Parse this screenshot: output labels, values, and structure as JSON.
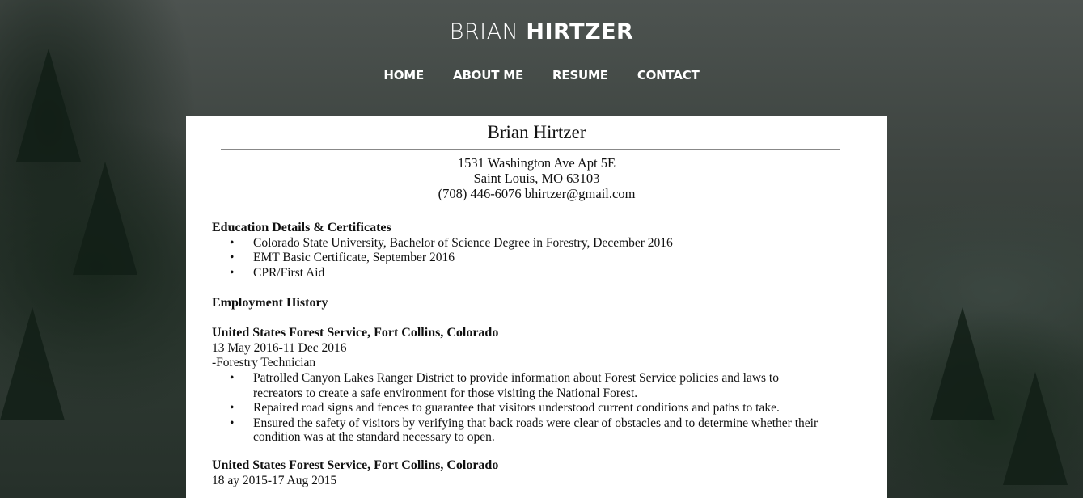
{
  "site": {
    "brand_first": "BRIAN",
    "brand_last": "HIRTZER",
    "nav": [
      "HOME",
      "ABOUT ME",
      "RESUME",
      "CONTACT"
    ]
  },
  "resume": {
    "name": "Brian Hirtzer",
    "address_line1": "1531 Washington Ave Apt 5E",
    "address_line2": "Saint Louis, MO 63103",
    "contact_line": "(708) 446-6076 bhirtzer@gmail.com",
    "education_heading": "Education Details & Certificates",
    "education": [
      "Colorado State University, Bachelor of Science Degree in Forestry, December 2016",
      "EMT Basic Certificate, September 2016",
      "CPR/First Aid"
    ],
    "employment_heading": "Employment History",
    "jobs": [
      {
        "employer": "United States Forest Service, Fort Collins, Colorado",
        "dates": "13 May 2016-11 Dec 2016",
        "title": "-Forestry Technician",
        "duties": [
          "Patrolled Canyon Lakes Ranger District to provide information about Forest Service policies and laws to recreators to create a safe environment for those visiting the National Forest.",
          "Repaired road signs and fences to guarantee that visitors understood current conditions and paths to take.",
          "Ensured the safety of visitors by verifying that back roads were clear of obstacles and to determine whether their condition was at the standard necessary to open."
        ]
      },
      {
        "employer": "United States Forest Service, Fort Collins, Colorado",
        "dates": "18  ay 2015-17 Aug 2015"
      }
    ]
  },
  "colors": {
    "text_on_bg": "#ffffff",
    "paper": "#ffffff",
    "rule": "#888888"
  }
}
